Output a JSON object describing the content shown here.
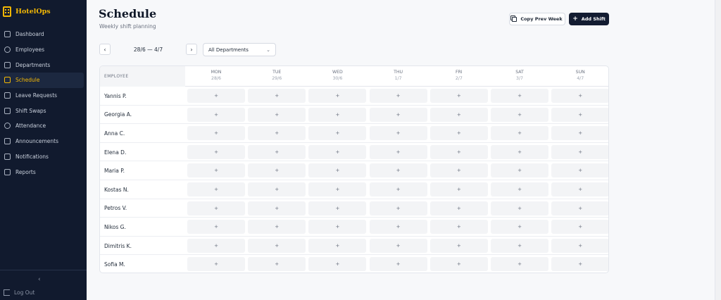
{
  "app": {
    "name": "HotelOps"
  },
  "sidebar": {
    "items": [
      {
        "label": "Dashboard",
        "icon": "dashboard-icon"
      },
      {
        "label": "Employees",
        "icon": "users-icon"
      },
      {
        "label": "Departments",
        "icon": "building-icon"
      },
      {
        "label": "Schedule",
        "icon": "calendar-icon",
        "active": true
      },
      {
        "label": "Leave Requests",
        "icon": "clipboard-icon"
      },
      {
        "label": "Shift Swaps",
        "icon": "swap-icon"
      },
      {
        "label": "Attendance",
        "icon": "clock-icon"
      },
      {
        "label": "Announcements",
        "icon": "megaphone-icon"
      },
      {
        "label": "Notifications",
        "icon": "bell-icon"
      },
      {
        "label": "Reports",
        "icon": "bar-chart-icon"
      }
    ],
    "collapse_glyph": "‹",
    "logout_label": "Log Out"
  },
  "header": {
    "title": "Schedule",
    "subtitle": "Weekly shift planning",
    "copy_label": "Copy Prev Week",
    "add_label": "Add Shift",
    "add_glyph": "+"
  },
  "toolbar": {
    "prev_glyph": "‹",
    "next_glyph": "›",
    "range": "28/6 — 4/7",
    "department": "All Departments"
  },
  "grid": {
    "employee_header": "EMPLOYEE",
    "days": [
      {
        "name": "MON",
        "date": "28/6"
      },
      {
        "name": "TUE",
        "date": "29/6"
      },
      {
        "name": "WED",
        "date": "30/6"
      },
      {
        "name": "THU",
        "date": "1/7"
      },
      {
        "name": "FRI",
        "date": "2/7"
      },
      {
        "name": "SAT",
        "date": "3/7"
      },
      {
        "name": "SUN",
        "date": "4/7"
      }
    ],
    "employees": [
      "Yannis P.",
      "Georgia A.",
      "Anna C.",
      "Elena D.",
      "Maria P.",
      "Kostas N.",
      "Petros V.",
      "Nikos G.",
      "Dimitris K.",
      "Sofia M."
    ],
    "cell_glyph": "+"
  },
  "colors": {
    "sidebar_bg": "#111a2e",
    "accent": "#f2b705",
    "primary_button": "#131c31"
  }
}
